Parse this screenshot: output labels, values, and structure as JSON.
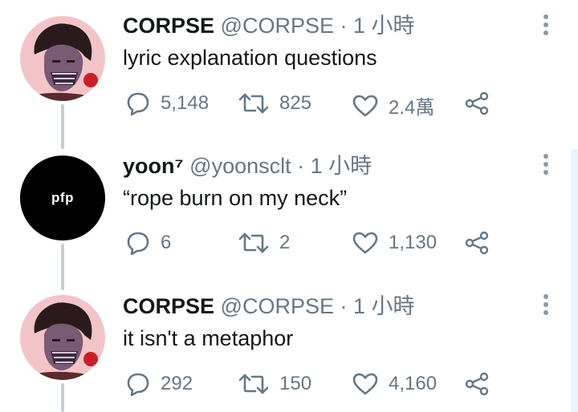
{
  "tweets": [
    {
      "name": "CORPSE",
      "handle": "@CORPSE",
      "separator": "·",
      "time": "1 小時",
      "text": "lyric explanation questions",
      "replies": "5,148",
      "retweets": "825",
      "likes": "2.4萬"
    },
    {
      "name": "yoon⁷",
      "handle": "@yoonsclt",
      "separator": "·",
      "time": "1 小時",
      "text": "“rope burn on my neck”",
      "avatar_text": "pfp",
      "replies": "6",
      "retweets": "2",
      "likes": "1,130"
    },
    {
      "name": "CORPSE",
      "handle": "@CORPSE",
      "separator": "·",
      "time": "1 小時",
      "text": "it isn't a metaphor",
      "replies": "292",
      "retweets": "150",
      "likes": "4,160"
    }
  ],
  "colors": {
    "text_primary": "#14171a",
    "text_secondary": "#657786",
    "thread_line": "#c4cfd6",
    "accent_rail": "#e8f5fd"
  },
  "icons": [
    "more-vertical-icon",
    "reply-icon",
    "retweet-icon",
    "like-icon",
    "share-icon"
  ]
}
